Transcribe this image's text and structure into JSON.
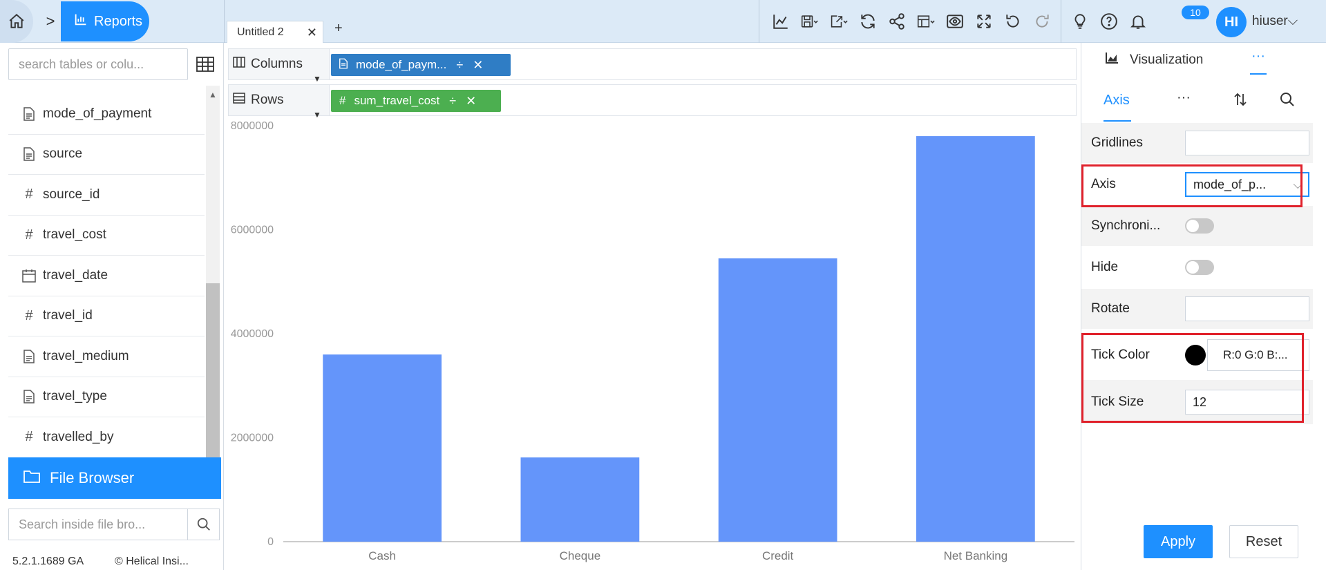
{
  "topbar": {
    "breadcrumb_section": "Reports",
    "doc_tab": "Untitled 2",
    "notifications_count": "10",
    "avatar_initials": "HI",
    "username": "hiuser"
  },
  "left_panel": {
    "search_placeholder": "search tables or colu...",
    "fields": [
      {
        "type": "text",
        "name": "mode_of_payment"
      },
      {
        "type": "text",
        "name": "source"
      },
      {
        "type": "number",
        "name": "source_id"
      },
      {
        "type": "number",
        "name": "travel_cost"
      },
      {
        "type": "date",
        "name": "travel_date"
      },
      {
        "type": "number",
        "name": "travel_id"
      },
      {
        "type": "text",
        "name": "travel_medium"
      },
      {
        "type": "text",
        "name": "travel_type"
      },
      {
        "type": "number",
        "name": "travelled_by"
      }
    ],
    "file_browser_label": "File Browser",
    "file_search_placeholder": "Search inside file bro...",
    "version": "5.2.1.1689 GA",
    "copyright": "© Helical Insi..."
  },
  "shelves": {
    "columns_label": "Columns",
    "columns_pill": "mode_of_paym...",
    "rows_label": "Rows",
    "rows_pill": "sum_travel_cost"
  },
  "chart_data": {
    "type": "bar",
    "categories": [
      "Cash",
      "Cheque",
      "Credit",
      "Net Banking"
    ],
    "values": [
      3600000,
      1620000,
      5450000,
      7800000
    ],
    "ylim": [
      0,
      8000000
    ],
    "yticks": [
      "0",
      "2000000",
      "4000000",
      "6000000",
      "8000000"
    ],
    "bar_color": "#6495fa",
    "grid": false
  },
  "right_panel": {
    "header": "Visualization",
    "header_more": "···",
    "tab_axis": "Axis",
    "tab_more": "···",
    "props": {
      "gridlines_label": "Gridlines",
      "axis_label": "Axis",
      "axis_value": "mode_of_p...",
      "sync_label": "Synchroni...",
      "hide_label": "Hide",
      "rotate_label": "Rotate",
      "tick_color_label": "Tick Color",
      "tick_color_value": "R:0 G:0 B:...",
      "tick_size_label": "Tick Size",
      "tick_size_value": "12"
    },
    "apply_label": "Apply",
    "reset_label": "Reset"
  },
  "colors": {
    "accent": "#1e90ff",
    "columns_pill": "#2f7dc5",
    "rows_pill": "#4caf50",
    "highlight": "#e0212b"
  }
}
